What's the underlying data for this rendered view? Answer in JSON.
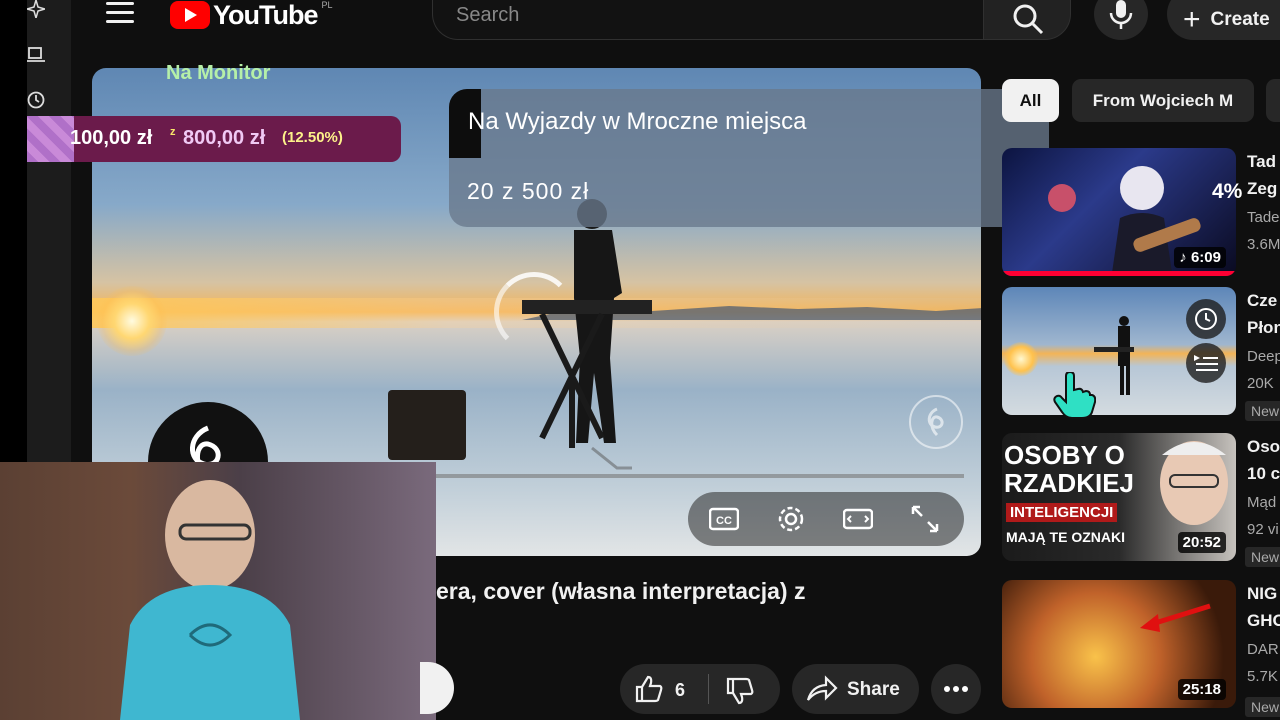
{
  "header": {
    "logo_text": "YouTube",
    "region": "PL",
    "search_placeholder": "Search",
    "create_label": "Create"
  },
  "overlays": {
    "na_monitor": "Na Monitor",
    "donation": {
      "current": "100,00 zł",
      "separator": "z",
      "target": "800,00 zł",
      "percent_text": "(12.50%)",
      "progress_fraction": 0.125
    },
    "goal_panel": {
      "title": "Na Wyjazdy w Mroczne miejsca",
      "amount": "20 z 500 zł"
    }
  },
  "video": {
    "title_fragment": "era, cover (własna interpretacja) z",
    "like_count": "6",
    "share_label": "Share"
  },
  "chips": [
    "All",
    "From Wojciech M"
  ],
  "sidebar_videos": [
    {
      "title": "Tad",
      "title2": "Zeg",
      "meta": "Tade",
      "meta2": "3.6M",
      "duration": "6:09",
      "percent": "4%"
    },
    {
      "title": "Cze",
      "title2": "Płon",
      "meta": "Deep",
      "meta2": "20K",
      "badge": "New"
    },
    {
      "title": "Oso",
      "title2": "10 c",
      "meta": "Mąd",
      "meta2": "92 vi",
      "badge": "New",
      "duration": "20:52",
      "thumb_text1": "OSOBY O",
      "thumb_text2": "RZADKIEJ",
      "thumb_text3": "INTELIGENCJI",
      "thumb_text4": "MAJĄ TE OZNAKI"
    },
    {
      "title": "NIG",
      "title2": "GHO",
      "meta": "DAR",
      "meta2": "5.7K",
      "badge": "New",
      "duration": "25:18"
    }
  ],
  "colors": {
    "brand": "#ff0000",
    "donation_bar": "#6b1b4b",
    "accent_green": "#b6f0a8"
  }
}
